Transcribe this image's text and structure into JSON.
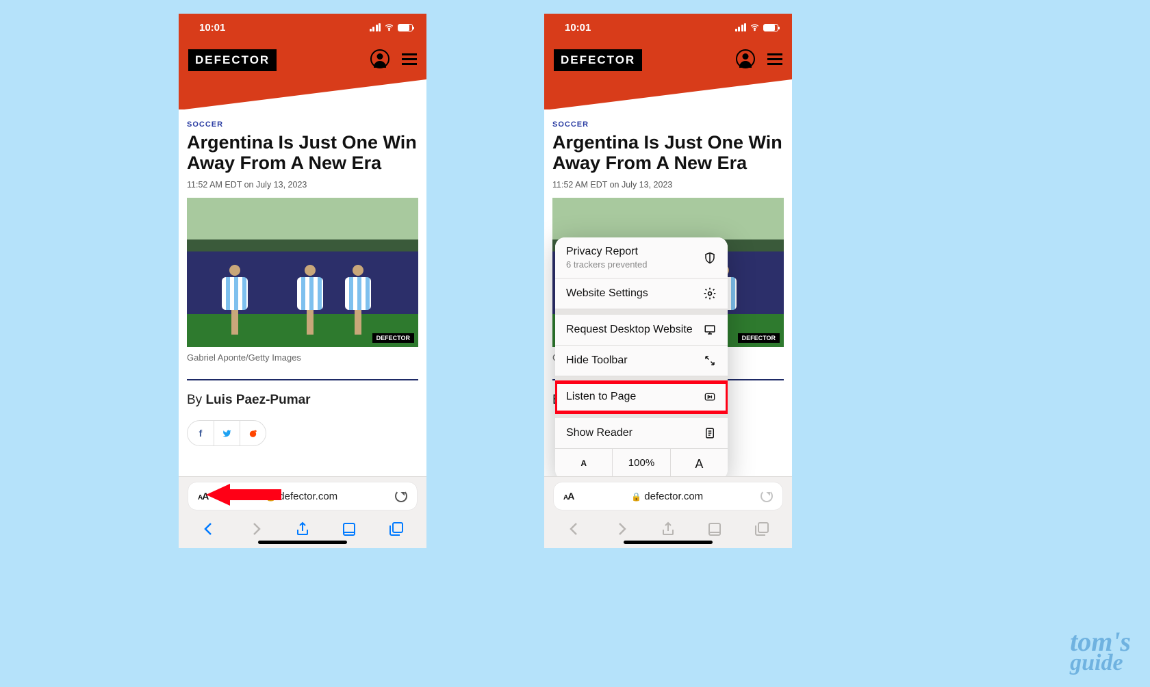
{
  "status": {
    "time": "10:01"
  },
  "site": {
    "logo": "DEFECTOR"
  },
  "article": {
    "category": "SOCCER",
    "headline": "Argentina Is Just One Win Away From A New Era",
    "timestamp": "11:52 AM EDT on July 13, 2023",
    "caption": "Gabriel Aponte/Getty Images",
    "byline_prefix": "By ",
    "byline_author": "Luis Paez-Pumar",
    "hero_badge": "DEFECTOR"
  },
  "safari": {
    "url": "defector.com",
    "aa_label": "AA"
  },
  "menu": {
    "privacy_report": "Privacy Report",
    "privacy_sub": "6 trackers prevented",
    "website_settings": "Website Settings",
    "request_desktop": "Request Desktop Website",
    "hide_toolbar": "Hide Toolbar",
    "listen_to_page": "Listen to Page",
    "show_reader": "Show Reader",
    "zoom_percent": "100%",
    "zoom_small": "A",
    "zoom_large": "A"
  },
  "watermark": {
    "line1": "tom's",
    "line2": "guide"
  }
}
